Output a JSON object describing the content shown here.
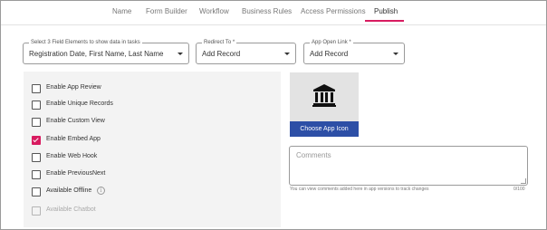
{
  "tabs": [
    {
      "label": "Name"
    },
    {
      "label": "Form Builder"
    },
    {
      "label": "Workflow"
    },
    {
      "label": "Business Rules"
    },
    {
      "label": "Access Permissions"
    },
    {
      "label": "Publish",
      "active": true
    }
  ],
  "fields": {
    "show_data": {
      "label": "Select 3 Field Elements to show data in tasks",
      "value": "Registration Date, First Name, Last Name"
    },
    "redirect": {
      "label": "Redirect To *",
      "value": "Add Record"
    },
    "app_open_link": {
      "label": "App Open Link *",
      "value": "Add Record"
    }
  },
  "options": [
    {
      "label": "Enable App Review",
      "checked": false,
      "disabled": false
    },
    {
      "label": "Enable Unique Records",
      "checked": false,
      "disabled": false
    },
    {
      "label": "Enable Custom View",
      "checked": false,
      "disabled": false
    },
    {
      "label": "Enable Embed App",
      "checked": true,
      "disabled": false
    },
    {
      "label": "Enable Web Hook",
      "checked": false,
      "disabled": false
    },
    {
      "label": "Enable PreviousNext",
      "checked": false,
      "disabled": false
    },
    {
      "label": "Available Offline",
      "checked": false,
      "disabled": false,
      "info_icon": "info-icon"
    },
    {
      "label": "Available Chatbot",
      "checked": false,
      "disabled": true
    }
  ],
  "app_icon": {
    "icon": "bank-building-icon",
    "button_label": "Choose App Icon"
  },
  "comments": {
    "placeholder": "Comments",
    "hint": "You can view comments added here in app versions to track changes",
    "counter": "0/100"
  },
  "colors": {
    "accent": "#d81b60",
    "primary_button": "#2d4fa6",
    "panel_bg": "#f3f3f3"
  }
}
